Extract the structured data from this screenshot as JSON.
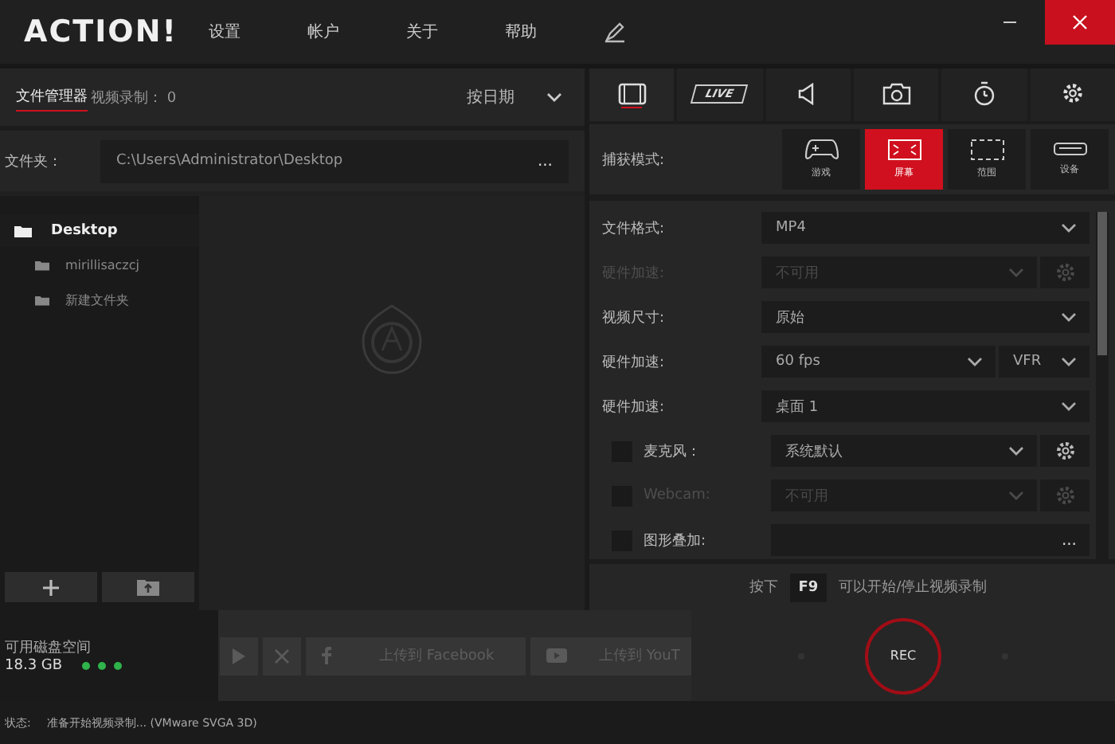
{
  "window": {
    "logo": "ACTION!",
    "menu": [
      "设置",
      "帐户",
      "关于",
      "帮助"
    ]
  },
  "file_panel": {
    "tabs": [
      {
        "label": "文件管理器",
        "selected": true
      },
      {
        "label": "视频录制： 0",
        "selected": false
      }
    ],
    "sort": "按日期",
    "folder_label": "文件夹：",
    "folder_path": "C:\\Users\\Administrator\\Desktop",
    "browse": "...",
    "tree": [
      {
        "name": "Desktop",
        "selected": true,
        "children": [
          {
            "name": "mirillisaczcj",
            "selected": false
          },
          {
            "name": "新建文件夹",
            "selected": false
          }
        ]
      }
    ]
  },
  "disk": {
    "label": "可用磁盘空间",
    "value": "18.3 GB"
  },
  "actions": {
    "facebook": "上传到 Facebook",
    "youtube": "上传到 YouT"
  },
  "settings": {
    "tabs": [
      {
        "kind": "film",
        "selected": true
      },
      {
        "kind": "live",
        "label": "LIVE",
        "selected": false
      },
      {
        "kind": "speaker",
        "selected": false
      },
      {
        "kind": "camera",
        "selected": false
      },
      {
        "kind": "timer",
        "selected": false
      },
      {
        "kind": "gear",
        "selected": false
      }
    ],
    "capture_label": "捕获模式:",
    "modes": [
      {
        "kind": "gamepad",
        "label": "游戏",
        "selected": false
      },
      {
        "kind": "screen",
        "label": "屏幕",
        "selected": true
      },
      {
        "kind": "area",
        "label": "范围",
        "selected": false
      },
      {
        "kind": "device",
        "label": "设备",
        "selected": false
      }
    ],
    "rows": [
      {
        "kind": "select",
        "label": "文件格式:",
        "value": "MP4",
        "disabled": false
      },
      {
        "kind": "select_gear",
        "label": "硬件加速:",
        "value": "不可用",
        "disabled": true
      },
      {
        "kind": "select",
        "label": "视频尺寸:",
        "value": "原始",
        "disabled": false
      },
      {
        "kind": "select_dual",
        "label": "硬件加速:",
        "value": "60 fps",
        "value2": "VFR",
        "disabled": false
      },
      {
        "kind": "select",
        "label": "硬件加速:",
        "value": "桌面 1",
        "disabled": false
      },
      {
        "kind": "check_select_gear",
        "label": "麦克风：",
        "value": "系统默认",
        "checked": false,
        "disabled": false
      },
      {
        "kind": "check_select_gear",
        "label": "Webcam:",
        "value": "不可用",
        "checked": false,
        "disabled": true
      },
      {
        "kind": "check_field",
        "label": "图形叠加:",
        "value": "...",
        "checked": false,
        "disabled": false
      }
    ],
    "hotkey": {
      "before": "按下",
      "key": "F9",
      "after": "可以开始/停止视频录制"
    },
    "rec": "REC"
  },
  "status": {
    "label": "状态:",
    "text": "准备开始视频录制... (VMware SVGA 3D)"
  }
}
